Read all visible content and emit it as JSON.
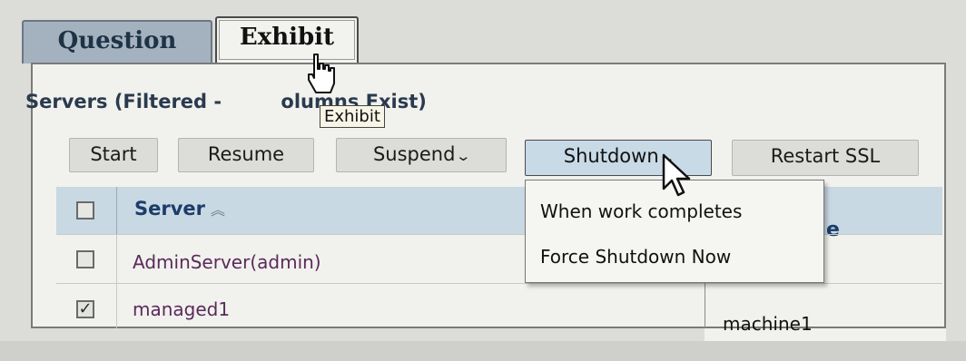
{
  "tabs": [
    {
      "label": "Question"
    },
    {
      "label": "Exhibit"
    }
  ],
  "tooltip": "Exhibit",
  "panel": {
    "title_left": "Servers (Filtered - ",
    "title_right": "olumns Exist)"
  },
  "toolbar": {
    "start": "Start",
    "resume": "Resume",
    "suspend": "Suspend",
    "shutdown": "Shutdown",
    "restart_ssl": "Restart SSL"
  },
  "table": {
    "columns": [
      "Server"
    ],
    "partial_header": "e",
    "rows": [
      {
        "server": "AdminServer(admin)",
        "checked": false
      },
      {
        "server": "managed1",
        "checked": true,
        "machine": "machine1"
      }
    ]
  },
  "shutdown_menu": {
    "items": [
      "When work completes",
      "Force Shutdown Now"
    ]
  },
  "icons": {
    "dropdown": "chevron-down-icon",
    "sort": "sort-ascending-icon",
    "hand_cursor": "hand-cursor-icon",
    "arrow_cursor": "arrow-cursor-icon"
  }
}
